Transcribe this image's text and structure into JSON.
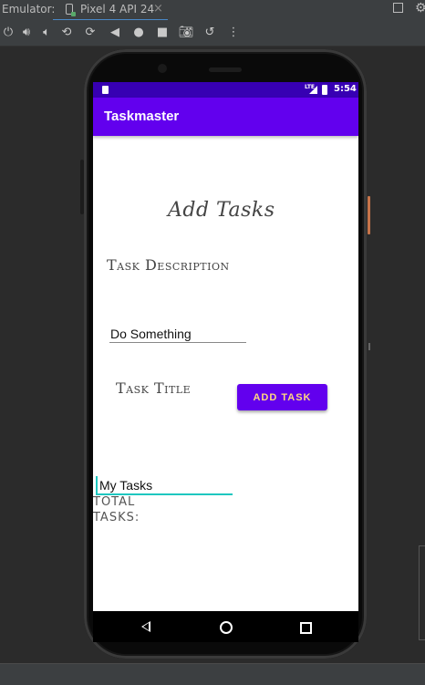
{
  "emulator": {
    "label": "Emulator:",
    "device_tab": "Pixel 4 API 24",
    "close_glyph": "×",
    "toolbar_icons": [
      "power-icon",
      "volume-up-icon",
      "volume-down-icon",
      "rotate-left-icon",
      "rotate-right-icon",
      "back-icon",
      "home-icon",
      "overview-icon",
      "camera-icon",
      "reset-icon",
      "more-icon"
    ]
  },
  "status_bar": {
    "network": "LTE",
    "time": "5:54"
  },
  "app": {
    "title": "Taskmaster",
    "heading": "Add Tasks",
    "description_label": "Task Description",
    "description_value": "Do Something",
    "title_label": "Task Title",
    "add_button": "ADD TASK",
    "my_tasks_value": "My Tasks",
    "total_tasks_label": "TOTAL TASKS:"
  },
  "colors": {
    "status_bar": "#3700b3",
    "app_bar": "#6200ee",
    "button": "#6200ee",
    "button_text": "#ffd980",
    "focus_underline": "#1ec7c0"
  }
}
